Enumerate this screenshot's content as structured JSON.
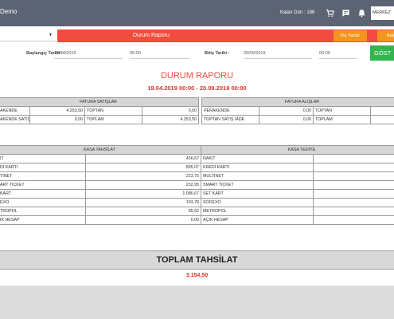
{
  "topbar": {
    "brand": "Demo",
    "credit": "Kalan Gün : 186",
    "icons": [
      "cart-icon",
      "chat-icon",
      "bell-icon"
    ],
    "branch": "MERKEZ"
  },
  "toolbar": {
    "select_value": "",
    "title": "Durum Raporu",
    "print_label": "Fiş Yazdır",
    "doc_label": "Belge"
  },
  "filter": {
    "start_label": "Başlangıç Tarihi :",
    "start_date": "19/04/2019",
    "start_time": "00:00",
    "end_label": "Bitiş Tarihi :",
    "end_date": "20/09/2019",
    "end_time": "00:00",
    "show_label": "GÖST"
  },
  "report": {
    "title": "DURUM RAPORU",
    "dates": "19.04.2019 00:00 - 20.09.2019 00:00",
    "sales": {
      "header": "FATURA SATIŞLAR",
      "rows": [
        [
          "AKENDE",
          "4.253,50",
          "TOPTAN",
          "0,00"
        ],
        [
          "AKENDE SATIŞ İADE",
          "0,00",
          "TOPLAM",
          "4.253,50"
        ]
      ]
    },
    "purchases": {
      "header": "FATURA ALIŞLAR",
      "rows": [
        [
          "PERAKENDE",
          "0,00",
          "TOPTAN",
          ""
        ],
        [
          "TOPTAN SATIŞ İADE",
          "0,00",
          "TOPLAM",
          ""
        ]
      ]
    },
    "kasa_tahsilat": {
      "header": "KASA TAHSİLAT",
      "rows": [
        [
          "IT",
          "456,67"
        ],
        [
          "DI KARTI",
          "895,07"
        ],
        [
          "TINET",
          "223,75"
        ],
        [
          "ART TICKET",
          "232,95"
        ],
        [
          "KART",
          "1.086,67"
        ],
        [
          "EXO",
          "193,78"
        ],
        [
          "TROPOL",
          "65,62"
        ],
        [
          "IK HESAP",
          "0,00"
        ]
      ]
    },
    "kasa_tediye": {
      "header": "KASA TEDİYE",
      "rows": [
        [
          "NAKİT",
          ""
        ],
        [
          "KREDİ KARTI",
          ""
        ],
        [
          "MULTINET",
          ""
        ],
        [
          "SMART TICKET",
          ""
        ],
        [
          "SET KART",
          ""
        ],
        [
          "SODEXO",
          ""
        ],
        [
          "METROPOL",
          ""
        ],
        [
          "AÇIK HESAP",
          ""
        ]
      ]
    },
    "total_label": "TOPLAM TAHSİLAT",
    "total_value": "3.154,50"
  }
}
